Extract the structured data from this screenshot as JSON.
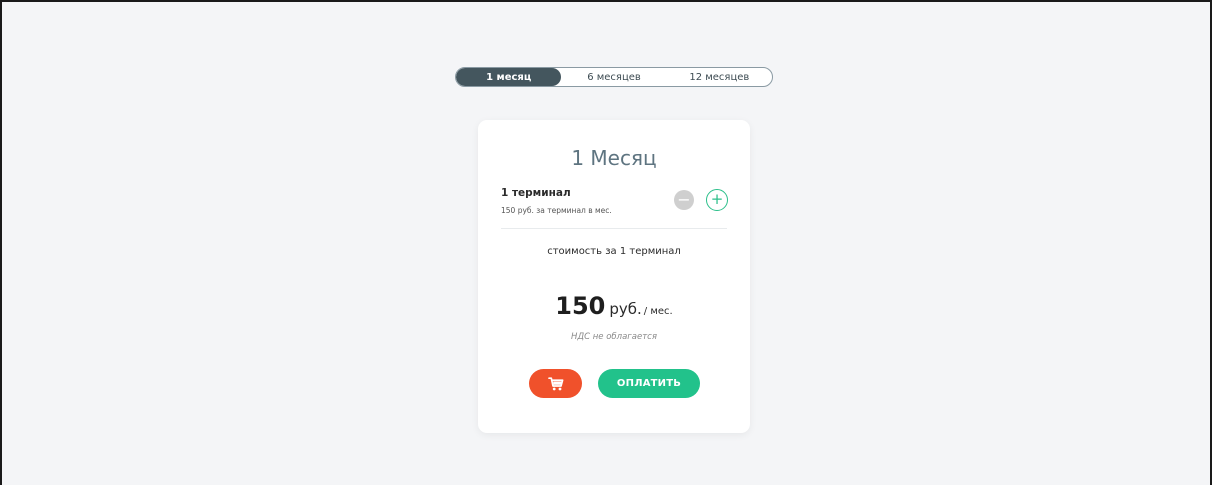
{
  "tabs": [
    {
      "label": "1 месяц",
      "active": true
    },
    {
      "label": "6 месяцев",
      "active": false
    },
    {
      "label": "12 месяцев",
      "active": false
    }
  ],
  "card": {
    "title": "1 Месяц",
    "terminal_count": "1 терминал",
    "terminal_price": "150 руб. за терминал в мес.",
    "stepper_minus": "−",
    "stepper_plus": "+",
    "cost_label": "стоимость за 1 терминал",
    "price_amount": "150",
    "price_currency": "руб.",
    "price_period": "/ мес.",
    "vat_note": "НДС не облагается",
    "pay_label": "ОПЛАТИТЬ"
  },
  "icons": {
    "cart": "cart-icon"
  },
  "colors": {
    "active_tab": "#44565e",
    "cart_button": "#f0512b",
    "pay_button": "#22c28b",
    "plus_accent": "#2bbf8a"
  }
}
